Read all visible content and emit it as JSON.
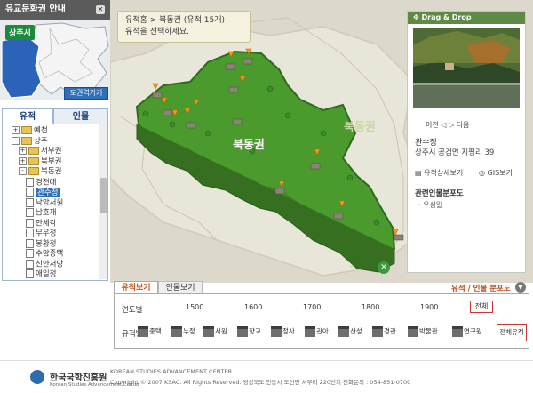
{
  "left": {
    "header_title": "유교문화권 안내",
    "province_label": "상주시",
    "return_button": "도권역가기",
    "tabs": [
      "유적",
      "인물"
    ],
    "tree": [
      {
        "label": "예천",
        "type": "folder",
        "expander": "+"
      },
      {
        "label": "상주",
        "type": "folder",
        "expander": "-"
      },
      {
        "label": "서부권",
        "type": "folder",
        "expander": "+"
      },
      {
        "label": "북부권",
        "type": "folder",
        "expander": "+"
      },
      {
        "label": "북동권",
        "type": "folder",
        "expander": "-"
      },
      {
        "label": "경천대",
        "type": "page"
      },
      {
        "label": "관수정",
        "type": "page",
        "selected": true
      },
      {
        "label": "낙암서원",
        "type": "page"
      },
      {
        "label": "남호재",
        "type": "page"
      },
      {
        "label": "만세각",
        "type": "page"
      },
      {
        "label": "무우정",
        "type": "page"
      },
      {
        "label": "봉황정",
        "type": "page"
      },
      {
        "label": "수암종택",
        "type": "page"
      },
      {
        "label": "신안서당",
        "type": "page"
      },
      {
        "label": "애일정",
        "type": "page"
      }
    ]
  },
  "map": {
    "banner_line1": "유적홈 > 북동권 (유적 15개)",
    "banner_line2": "유적을 선택하세요.",
    "outer_label": "북동권",
    "green_label": "북동권"
  },
  "dragdrop": {
    "title": "Drag & Drop",
    "prev": "이전",
    "next": "다음",
    "name": "관수정",
    "address": "상주시 공검면 지평리 39",
    "detail_link": "유적상세보기",
    "gis_link": "GIS보기",
    "related_title": "관련인물분포도",
    "related_person": "우성일"
  },
  "panel": {
    "tab_sites": "유적보기",
    "tab_people": "인물보기",
    "title": "유적 / 인물 분포도",
    "year_label": "연도별",
    "years": [
      "1500",
      "1600",
      "1700",
      "1800",
      "1900"
    ],
    "all_years": "전체",
    "type_label": "유적별",
    "types": [
      "종택",
      "누정",
      "서원",
      "향교",
      "정사",
      "관아",
      "산성",
      "경관",
      "박물관",
      "연구원"
    ],
    "all_sites": "전체유적"
  },
  "footer": {
    "logo_ko": "한국국학진흥원",
    "logo_en": "Korean Studies Advancement Center",
    "org": "KOREAN STUDIES ADVANCEMENT CENTER",
    "copyright": "Copyright © 2007 KSAC. All Rights Reserved. 경상북도 안동시 도산면 서부리 220번지 전화문의 : 054-851-0700"
  },
  "colors": {
    "green_region": "#4a9a2e",
    "accent_orange": "#c6511c",
    "selection_blue": "#2e6fba"
  }
}
